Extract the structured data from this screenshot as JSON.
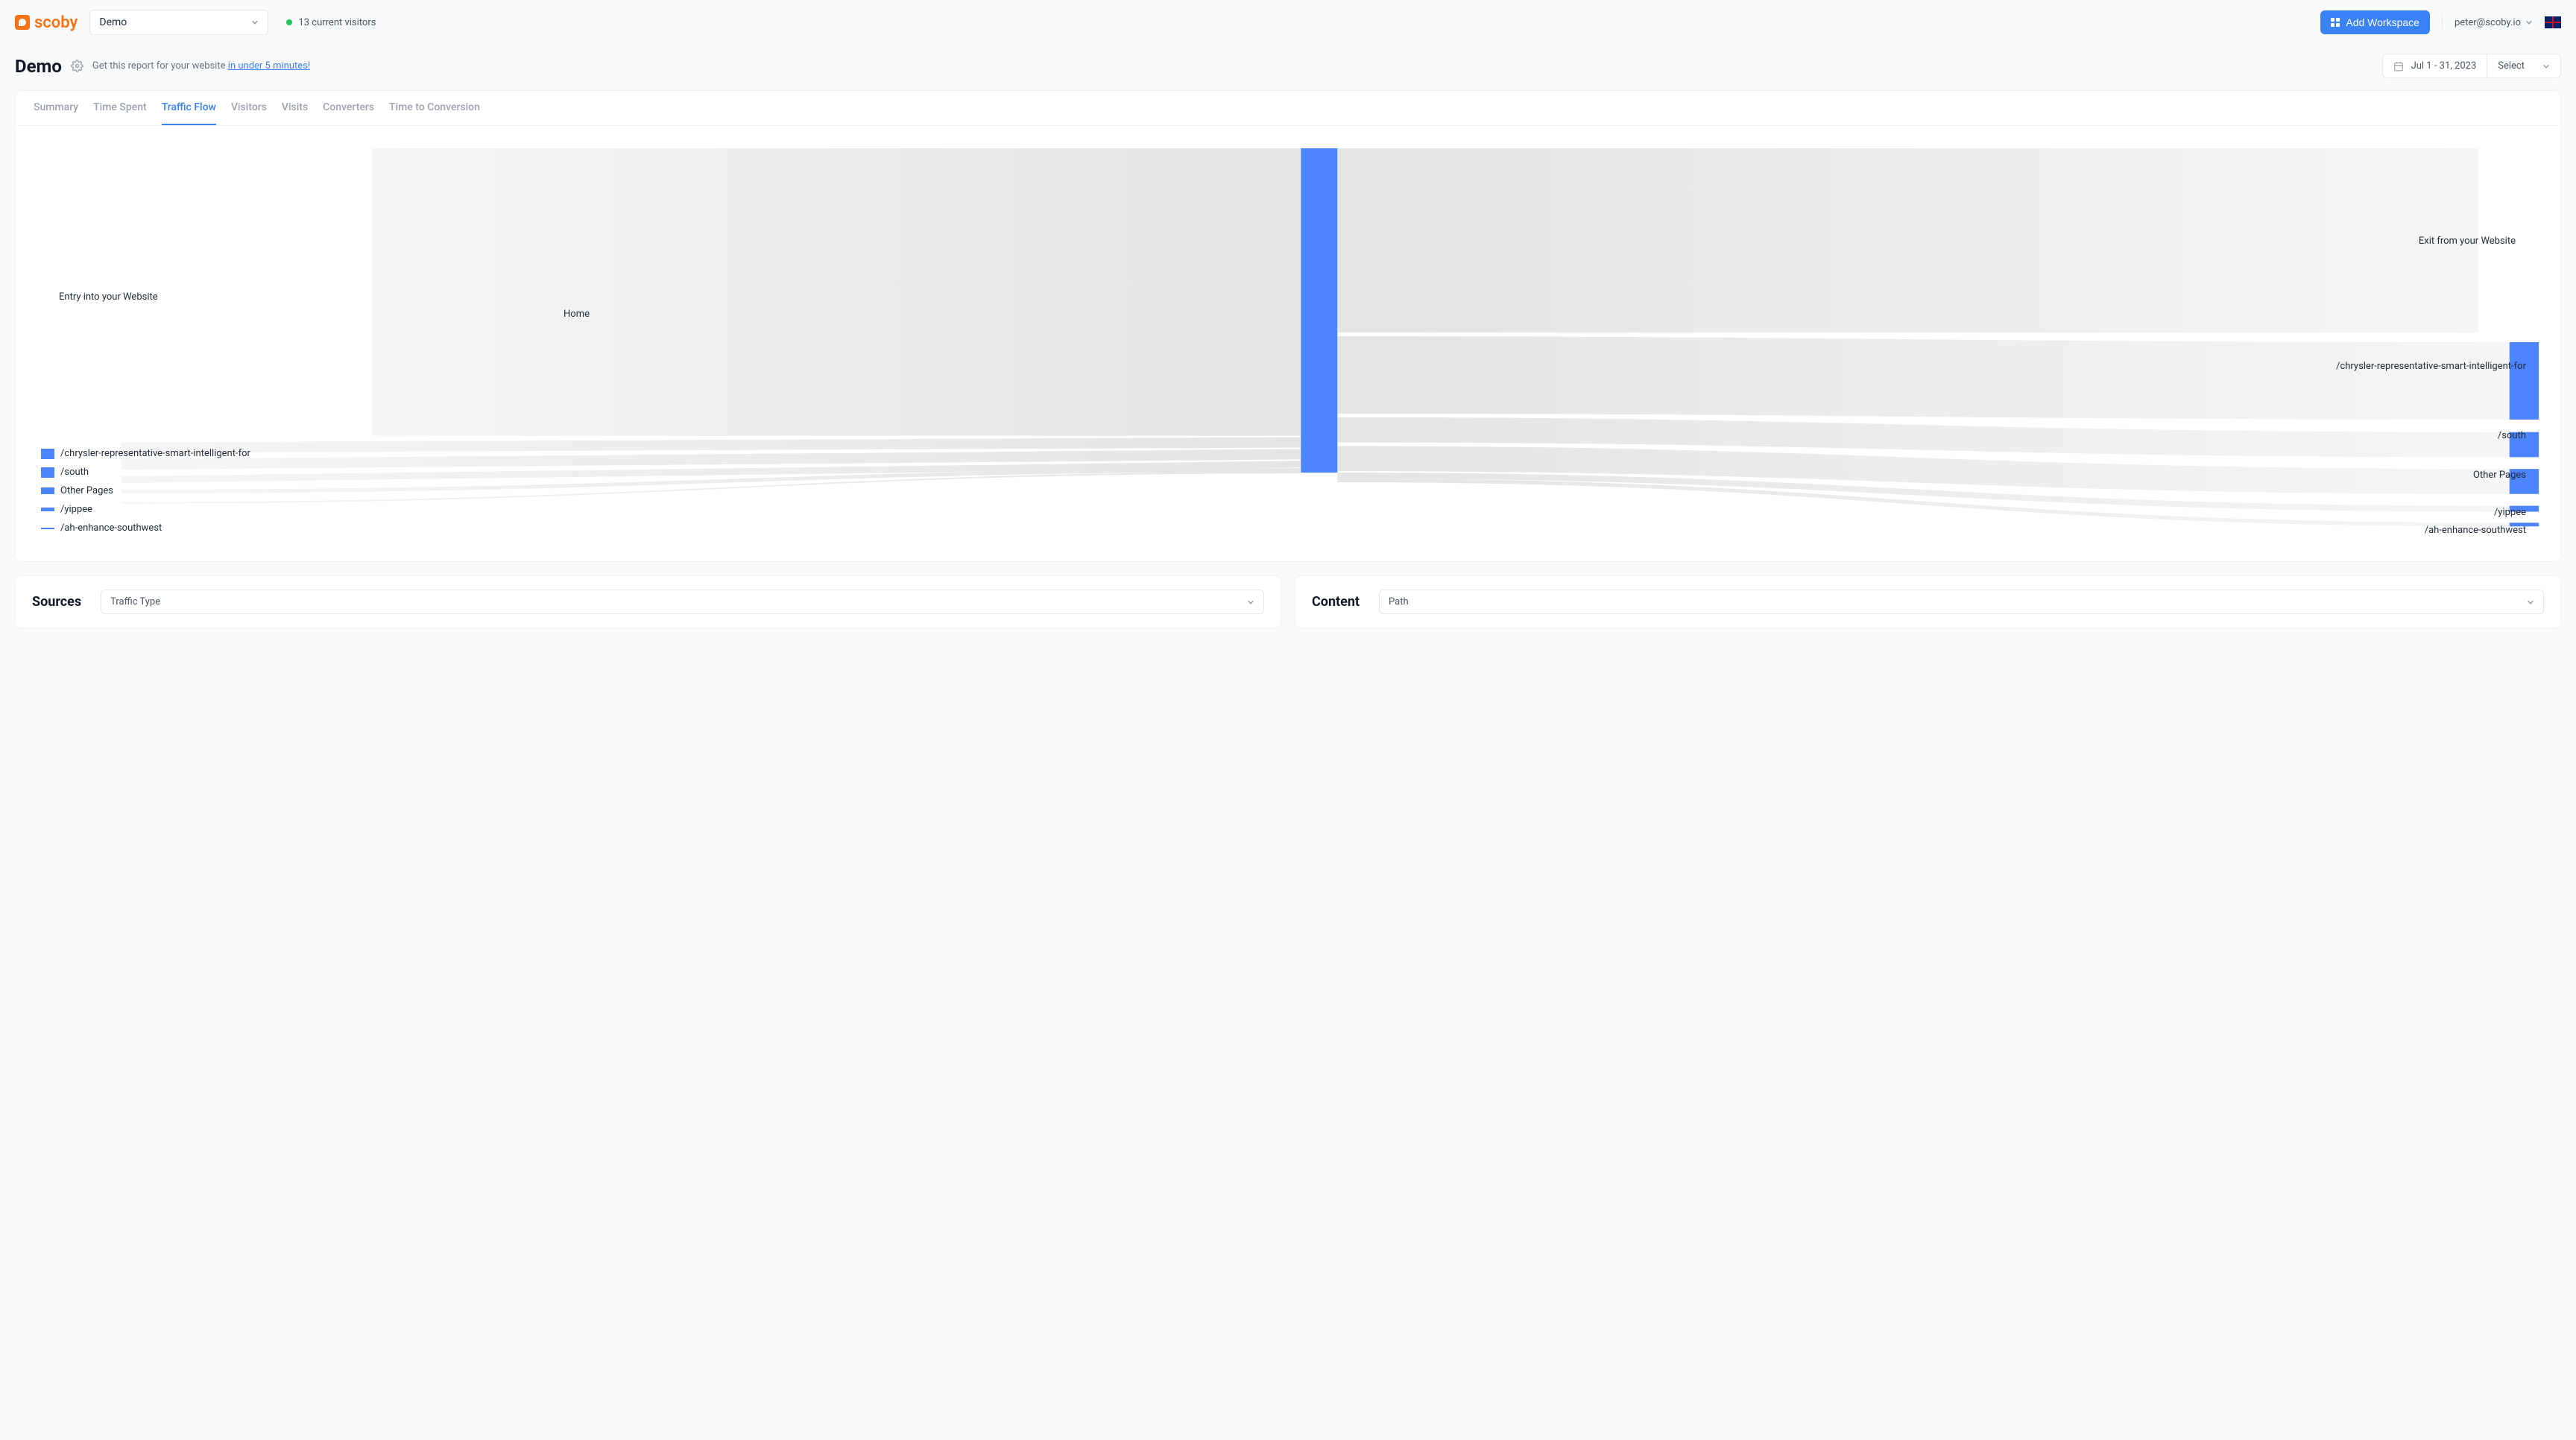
{
  "header": {
    "brand_name": "scoby",
    "workspace_selected": "Demo",
    "visitors_status": "13 current visitors",
    "add_workspace_label": "Add Workspace",
    "user_email": "peter@scoby.io"
  },
  "page": {
    "title": "Demo",
    "promo_prefix": "Get this report for your website",
    "promo_link": "in under 5 minutes!",
    "date_range": "Jul 1 - 31, 2023",
    "select_label": "Select"
  },
  "tabs": [
    "Summary",
    "Time Spent",
    "Traffic Flow",
    "Visitors",
    "Visits",
    "Converters",
    "Time to Conversion"
  ],
  "active_tab": "Traffic Flow",
  "sankey": {
    "entry_label": "Entry into your Website",
    "center_label": "Home",
    "exit_label": "Exit from your Website",
    "left_items": [
      {
        "label": "/chrysler-representative-smart-intelligent-for",
        "w": 18,
        "h": 14
      },
      {
        "label": "/south",
        "w": 18,
        "h": 14
      },
      {
        "label": "Other Pages",
        "w": 18,
        "h": 9
      },
      {
        "label": "/yippee",
        "w": 18,
        "h": 5
      },
      {
        "label": "/ah-enhance-southwest",
        "w": 18,
        "h": 2
      }
    ],
    "right_items": [
      {
        "label": "/chrysler-representative-smart-intelligent-for",
        "h": 105
      },
      {
        "label": "/south",
        "h": 34
      },
      {
        "label": "Other Pages",
        "h": 34
      },
      {
        "label": "/yippee",
        "h": 8
      },
      {
        "label": "/ah-enhance-southwest",
        "h": 5
      }
    ]
  },
  "bottom": {
    "sources": {
      "title": "Sources",
      "dropdown": "Traffic Type"
    },
    "content": {
      "title": "Content",
      "dropdown": "Path"
    }
  },
  "chart_data": {
    "type": "sankey",
    "title": "Traffic Flow",
    "nodes": {
      "source": {
        "label": "Entry into your Website",
        "relative_weight": 390
      },
      "center": {
        "label": "Home",
        "relative_weight": 440
      },
      "exit": {
        "label": "Exit from your Website",
        "relative_weight": 250
      },
      "left_leaves": [
        {
          "label": "/chrysler-representative-smart-intelligent-for",
          "relative_weight": 14
        },
        {
          "label": "/south",
          "relative_weight": 14
        },
        {
          "label": "Other Pages",
          "relative_weight": 9
        },
        {
          "label": "/yippee",
          "relative_weight": 5
        },
        {
          "label": "/ah-enhance-southwest",
          "relative_weight": 2
        }
      ],
      "right_leaves": [
        {
          "label": "/chrysler-representative-smart-intelligent-for",
          "relative_weight": 105
        },
        {
          "label": "/south",
          "relative_weight": 34
        },
        {
          "label": "Other Pages",
          "relative_weight": 34
        },
        {
          "label": "/yippee",
          "relative_weight": 8
        },
        {
          "label": "/ah-enhance-southwest",
          "relative_weight": 5
        }
      ]
    },
    "links": {
      "description": "All left leaves and Entry flow into Home; Home flows to Exit and all right leaves"
    }
  }
}
